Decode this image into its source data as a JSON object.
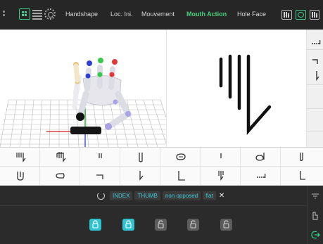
{
  "toolbar": {
    "tabs": [
      {
        "label": "Handshape",
        "active": false
      },
      {
        "label": "Loc. Ini.",
        "active": false
      },
      {
        "label": "Mouvement",
        "active": false
      },
      {
        "label": "Mouth Action",
        "active": true
      },
      {
        "label": "Hole Face",
        "active": false
      }
    ],
    "left_icons": [
      "grid-view-icon",
      "list-view-icon",
      "settings-gear-icon"
    ],
    "right_icons": [
      "hand-view-icon",
      "record-icon",
      "signing-hand-icon"
    ],
    "accent_color": "#49d27f"
  },
  "viewport": {
    "left": "3d-hand-scene",
    "right": "handshape-notation-symbol"
  },
  "side_strip": {
    "symbols": [
      "dotted-line-symbol",
      "hook-symbol",
      "bent-stem-symbol"
    ]
  },
  "palette": {
    "row1": [
      "fingers-tilde-symbol",
      "fingers-bent-symbol",
      "two-strokes-symbol",
      "loop-stem-symbol",
      "closed-hand-symbol",
      "single-stroke-symbol",
      "thumb-curve-symbol",
      "hook-stroke-symbol"
    ],
    "row2": [
      "hand-spread-symbol",
      "oval-hand-symbol",
      "hook-right-symbol",
      "bent-stroke-symbol",
      "l-shape-symbol",
      "double-bent-symbol",
      "dotted-line-symbol",
      "stem-foot-symbol"
    ]
  },
  "filter": {
    "chips": [
      "INDEX",
      "THUMB",
      "non opposed",
      "flat"
    ],
    "chip_color": "#3fc9d6"
  },
  "locks": [
    {
      "state": "locked",
      "color": "#2fc3cf"
    },
    {
      "state": "locked",
      "color": "#2fc3cf"
    },
    {
      "state": "unlocked",
      "color": "#5c5c5c"
    },
    {
      "state": "unlocked",
      "color": "#5c5c5c"
    },
    {
      "state": "unlocked",
      "color": "#5c5c5c"
    }
  ],
  "right_rail": [
    "filter-icon",
    "hand-pointer-icon",
    "logout-icon"
  ]
}
